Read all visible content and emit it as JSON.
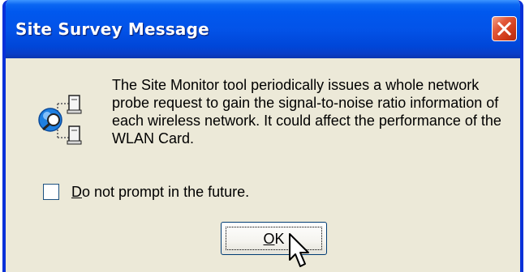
{
  "window": {
    "title": "Site Survey Message",
    "close_icon": "close-icon"
  },
  "dialog": {
    "icon": "site-monitor-icon",
    "message": "The Site Monitor tool periodically issues a whole network probe request to gain the signal-to-noise ratio information of each wireless network. It could affect the performance of the WLAN Card."
  },
  "checkbox": {
    "label": "Do not prompt in the future.",
    "checked": false
  },
  "ok_button": {
    "label": "OK"
  },
  "colors": {
    "titlebar_blue": "#0353e8",
    "border_blue": "#0831d9",
    "close_red": "#cf3a18",
    "dialog_background": "#ece9d8"
  }
}
